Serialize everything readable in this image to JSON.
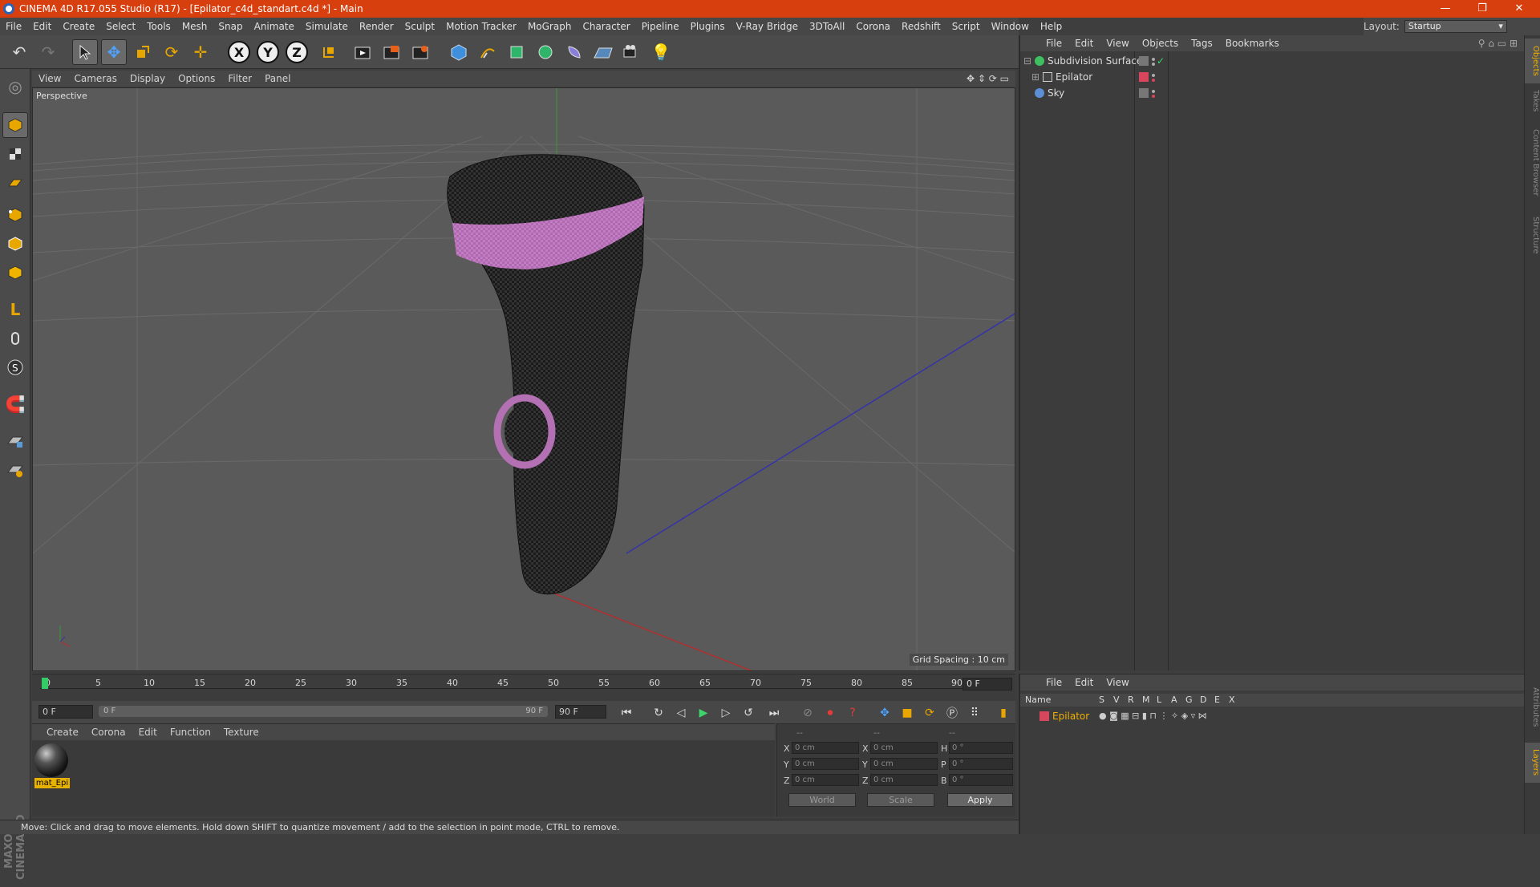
{
  "window": {
    "title": "CINEMA 4D R17.055 Studio (R17) - [Epilator_c4d_standart.c4d *] - Main",
    "minimize": "—",
    "restore": "❐",
    "close": "✕"
  },
  "menubar": {
    "items": [
      "File",
      "Edit",
      "Create",
      "Select",
      "Tools",
      "Mesh",
      "Snap",
      "Animate",
      "Simulate",
      "Render",
      "Sculpt",
      "Motion Tracker",
      "MoGraph",
      "Character",
      "Pipeline",
      "Plugins",
      "V-Ray Bridge",
      "3DToAll",
      "Corona",
      "Redshift",
      "Script",
      "Window",
      "Help"
    ]
  },
  "layout": {
    "label": "Layout:",
    "value": "Startup"
  },
  "toolbar": {
    "icons": [
      "undo-icon",
      "redo-icon",
      "select-icon",
      "move-icon",
      "scale-icon",
      "rotate-icon",
      "live-select-icon",
      "x-axis-icon",
      "y-axis-icon",
      "z-axis-icon",
      "coordinate-system-icon",
      "render-view-icon",
      "render-picture-viewer-icon",
      "render-settings-icon",
      "cube-icon",
      "pen-icon",
      "subdivision-icon",
      "array-icon",
      "deformer-icon",
      "floor-icon",
      "camera-icon",
      "light-icon"
    ],
    "x_label": "X",
    "y_label": "Y",
    "z_label": "Z"
  },
  "viewport": {
    "menu": [
      "View",
      "Cameras",
      "Display",
      "Options",
      "Filter",
      "Panel"
    ],
    "label": "Perspective",
    "grid_spacing": "Grid Spacing : 10 cm"
  },
  "timeline": {
    "ticks": [
      "0",
      "5",
      "10",
      "15",
      "20",
      "25",
      "30",
      "35",
      "40",
      "45",
      "50",
      "55",
      "60",
      "65",
      "70",
      "75",
      "80",
      "85",
      "90"
    ],
    "current_frame": "0 F",
    "start_field": "0 F",
    "slider_start": "0 F",
    "slider_end": "90 F",
    "end_field": "90 F"
  },
  "materials": {
    "menu": [
      "Create",
      "Corona",
      "Edit",
      "Function",
      "Texture"
    ],
    "items": [
      {
        "name": "mat_Epi"
      }
    ]
  },
  "coordinates": {
    "header": [
      "--",
      "--",
      "--"
    ],
    "rows": [
      {
        "a": "X",
        "av": "0 cm",
        "b": "X",
        "bv": "0 cm",
        "c": "H",
        "cv": "0 °"
      },
      {
        "a": "Y",
        "av": "0 cm",
        "b": "Y",
        "bv": "0 cm",
        "c": "P",
        "cv": "0 °"
      },
      {
        "a": "Z",
        "av": "0 cm",
        "b": "Z",
        "bv": "0 cm",
        "c": "B",
        "cv": "0 °"
      }
    ],
    "mode1": "World",
    "mode2": "Scale",
    "apply": "Apply"
  },
  "status": "Move: Click and drag to move elements. Hold down SHIFT to quantize movement / add to the selection in point mode, CTRL to remove.",
  "objects": {
    "menu": [
      "File",
      "Edit",
      "View",
      "Objects",
      "Tags",
      "Bookmarks"
    ],
    "items": [
      {
        "name": "Subdivision Surface",
        "color": "#3fbf5f"
      },
      {
        "name": "Epilator",
        "color": "#cfcfcf"
      },
      {
        "name": "Sky",
        "color": "#5c8fd6"
      }
    ]
  },
  "layers": {
    "menu": [
      "File",
      "Edit",
      "View"
    ],
    "columns": [
      "Name",
      "S",
      "V",
      "R",
      "M",
      "L",
      "A",
      "G",
      "D",
      "E",
      "X"
    ],
    "items": [
      {
        "name": "Epilator",
        "color": "#d6465c"
      }
    ]
  },
  "sidetabs": [
    "Objects",
    "Takes",
    "Content Browser",
    "Structure",
    "Attributes",
    "Layers"
  ],
  "maxon": "MAXON CINEMA 4D"
}
